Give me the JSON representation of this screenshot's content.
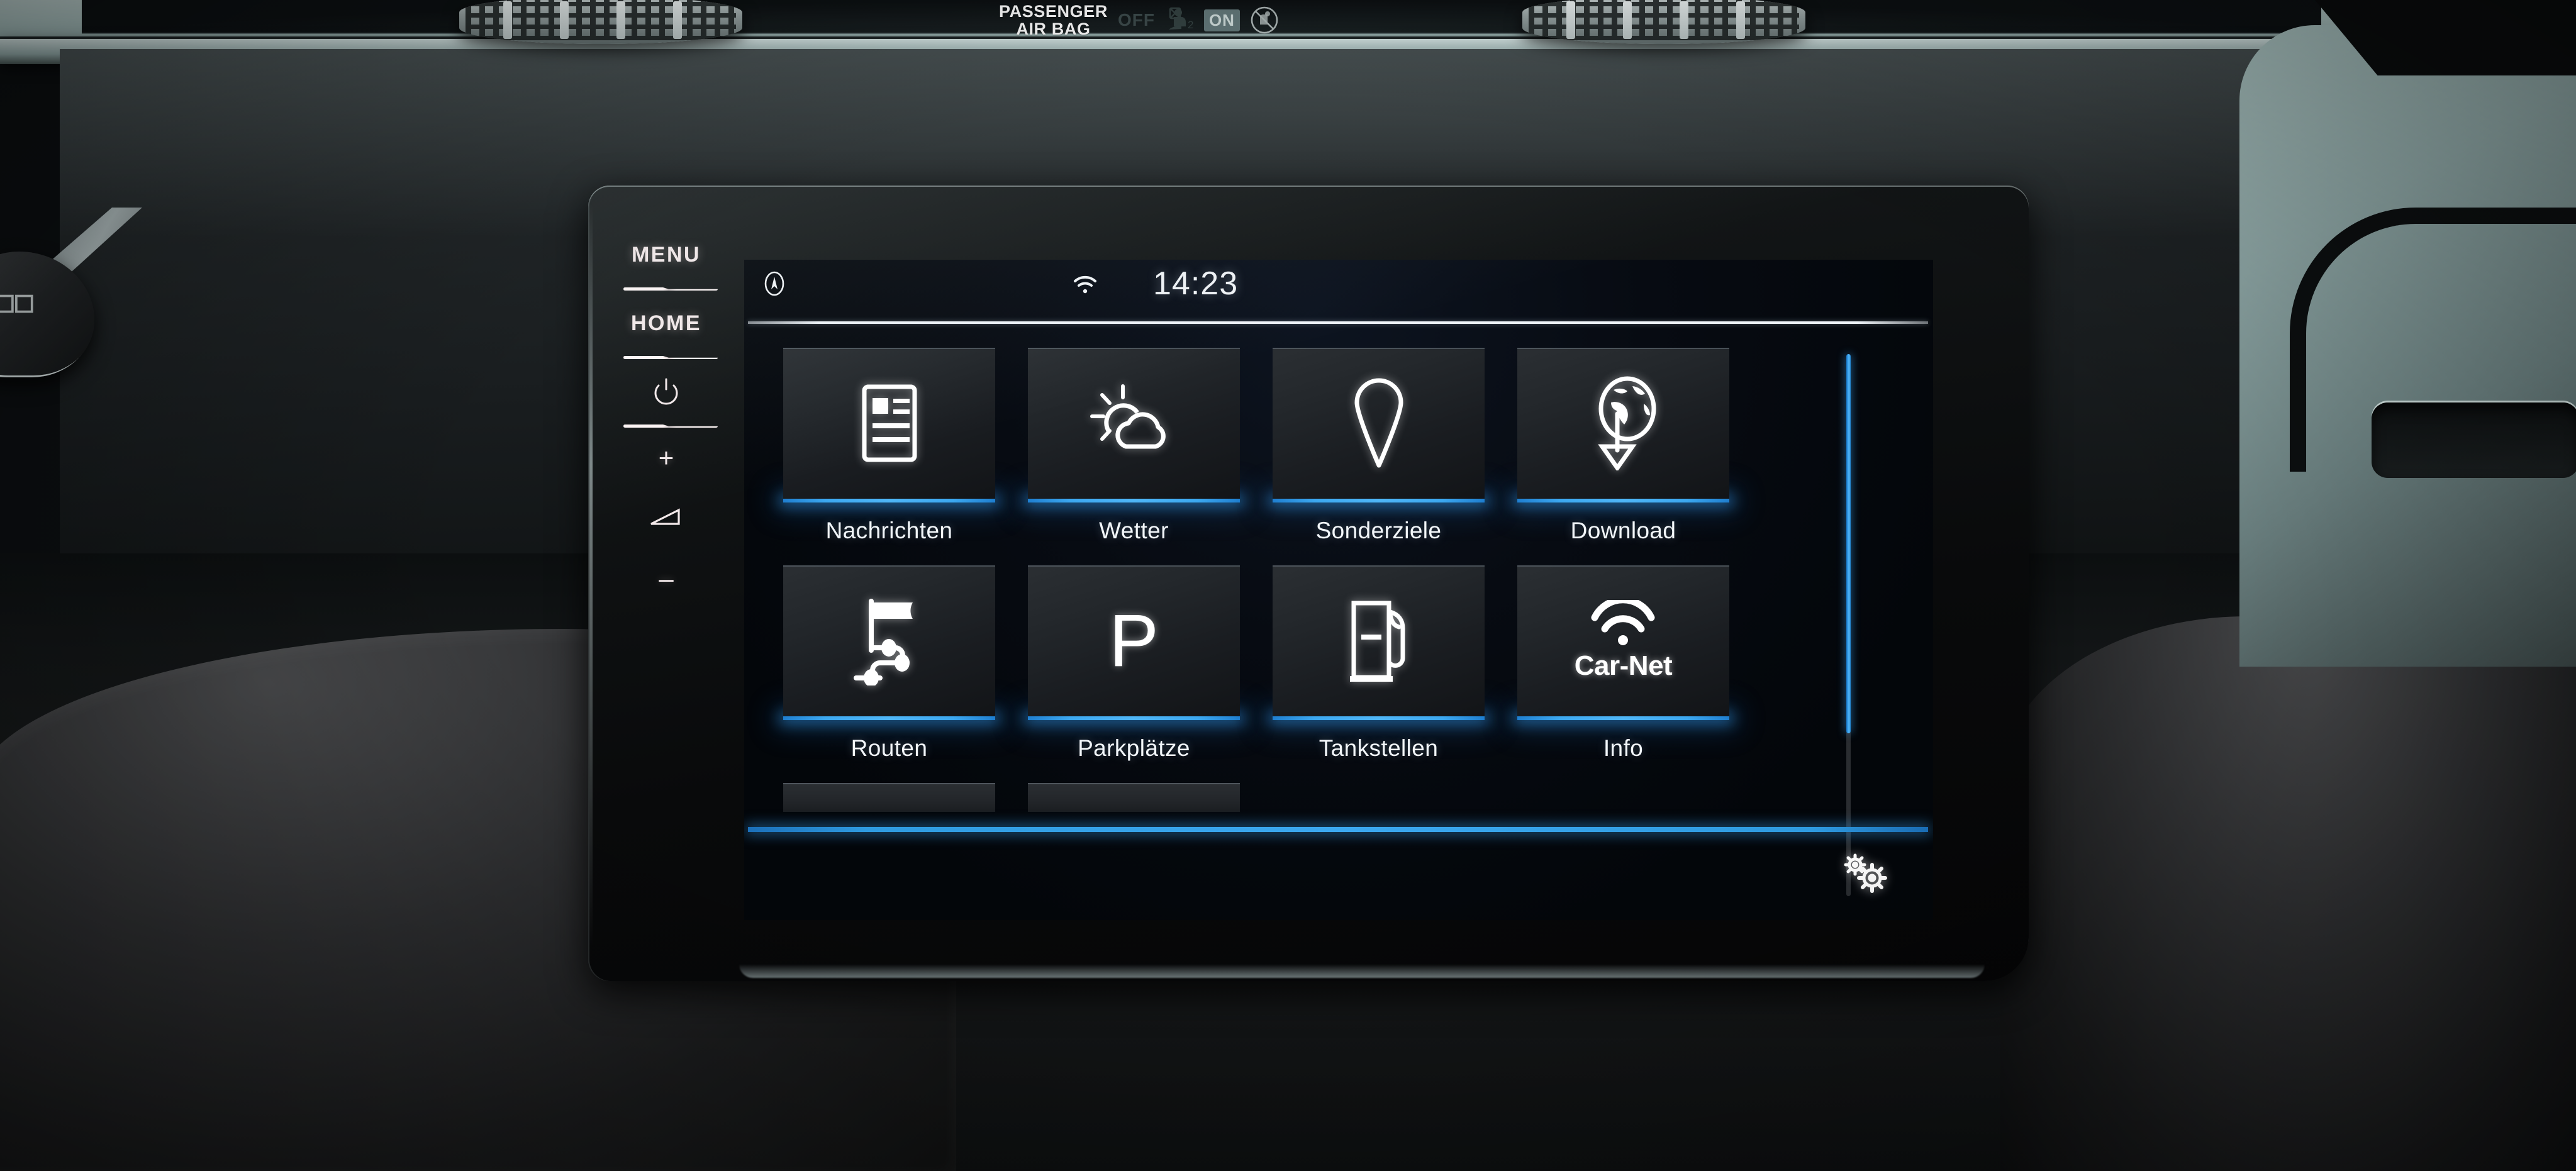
{
  "vehicle_interior": {
    "airbag_indicator": {
      "title_line1": "PASSENGER",
      "title_line2": "AIR BAG",
      "off_label": "OFF",
      "on_label": "ON",
      "off_icon": "airbag-seated-person-icon",
      "on_icon": "no-child-seat-icon"
    },
    "vents": [
      {
        "name": "vent-left"
      },
      {
        "name": "vent-right"
      }
    ],
    "colors": {
      "dash_trim_teal": "#a8bfbd",
      "console_dark": "#1a1d1f",
      "leather_grey": "#2e2f31"
    }
  },
  "head_unit": {
    "hardkeys": [
      {
        "type": "label",
        "label": "MENU",
        "name": "menu-button"
      },
      {
        "type": "divider",
        "name": "hardkey-divider-1"
      },
      {
        "type": "label",
        "label": "HOME",
        "name": "home-button"
      },
      {
        "type": "divider",
        "name": "hardkey-divider-2"
      },
      {
        "type": "icon",
        "label": "⏻",
        "name": "power-button"
      },
      {
        "type": "divider",
        "name": "hardkey-divider-3"
      },
      {
        "type": "icon",
        "label": "+",
        "name": "volume-up-button"
      },
      {
        "type": "icon",
        "label": "volume-icon",
        "name": "volume-indicator-icon"
      },
      {
        "type": "icon",
        "label": "–",
        "name": "volume-down-button"
      }
    ],
    "status_bar": {
      "nav_icon": "compass-icon",
      "wifi_icon": "wifi-icon",
      "time": "14:23"
    },
    "tiles": [
      {
        "label": "Nachrichten",
        "icon": "newspaper-icon",
        "accent": "#3ca8f0"
      },
      {
        "label": "Wetter",
        "icon": "sun-cloud-icon",
        "accent": "#3ca8f0"
      },
      {
        "label": "Sonderziele",
        "icon": "map-pin-icon",
        "accent": "#3ca8f0"
      },
      {
        "label": "Download",
        "icon": "globe-download-icon",
        "accent": "#3ca8f0"
      },
      {
        "label": "Routen",
        "icon": "route-flag-icon",
        "accent": "#3ca8f0"
      },
      {
        "label": "Parkplätze",
        "icon": "parking-p-icon",
        "accent": "#3ca8f0"
      },
      {
        "label": "Tankstellen",
        "icon": "fuel-pump-icon",
        "accent": "#3ca8f0"
      },
      {
        "label": "Info",
        "icon": "car-net-wifi-icon",
        "accent": "#3ca8f0",
        "glyph_text": "Car-Net"
      }
    ],
    "scrollbar": {
      "thumb_fraction_percent": 70
    },
    "bottom_bar": {
      "settings_icon": "gears-icon",
      "divider_color": "#3ca8f0"
    },
    "colors": {
      "screen_bg": "#04070c",
      "tile_bg": "#23272b",
      "accent_blue": "#3ca8f0",
      "text_primary": "#f2f6fa"
    }
  }
}
